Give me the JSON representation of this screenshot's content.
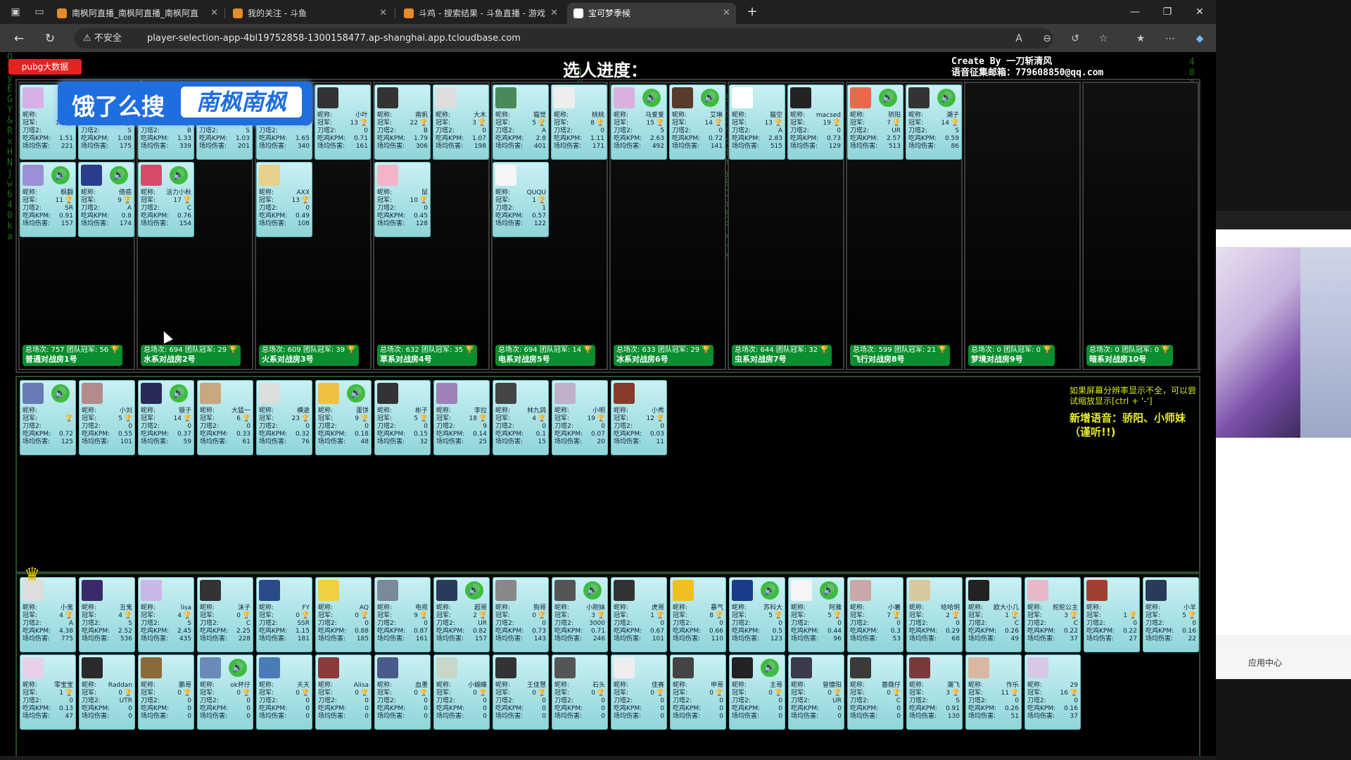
{
  "tabs": [
    {
      "title": "南枫阿直播_南枫阿直播_南枫阿直",
      "active": false
    },
    {
      "title": "我的关注 - 斗鱼",
      "active": false
    },
    {
      "title": "斗鸡 - 搜索结果 - 斗鱼直播 - 游戏",
      "active": false
    },
    {
      "title": "宝可梦季候",
      "active": true
    }
  ],
  "address": {
    "insecure_label": "不安全",
    "url": "player-selection-app-4bl19752858-1300158477.ap-shanghai.app.tcloudbase.com"
  },
  "page": {
    "pubg_button": "pubg大数据",
    "progress_title": "选人进度：",
    "credits_line1": "Create By 一刀斩清风",
    "credits_line2": "语音征集邮箱：779608850@qq.com",
    "banner_left": "饿了么搜",
    "banner_right": "南枫南枫",
    "hint": "如果屏幕分辨率显示不全，可以尝试缩放显示[ctrl + '-']",
    "hint2": "新增语音：骄阳、小师妹（谨听!!)"
  },
  "teams": [
    {
      "name": "普通对战房1号",
      "stats": "总场次: 757 团队冠军: 56"
    },
    {
      "name": "水系对战房2号",
      "stats": "总场次: 694 团队冠军: 29"
    },
    {
      "name": "火系对战房3号",
      "stats": "总场次: 609 团队冠军: 39"
    },
    {
      "name": "草系对战房4号",
      "stats": "总场次: 632 团队冠军: 35"
    },
    {
      "name": "电系对战房5号",
      "stats": "总场次: 694 团队冠军: 14"
    },
    {
      "name": "冰系对战房6号",
      "stats": "总场次: 633 团队冠军: 29"
    },
    {
      "name": "虫系对战房7号",
      "stats": "总场次: 644 团队冠军: 32"
    },
    {
      "name": "飞行对战房8号",
      "stats": "总场次: 599 团队冠军: 21"
    },
    {
      "name": "梦境对战房9号",
      "stats": "总场次: 0 团队冠军: 0"
    },
    {
      "name": "暗系对战房10号",
      "stats": "总场次: 0 团队冠军: 0"
    }
  ],
  "team_cards": [
    {
      "team": 0,
      "slot": 0,
      "name": "",
      "champ": "13",
      "tier": "",
      "kpm": "1.51",
      "dmg": "221",
      "color": "#d8b0e8"
    },
    {
      "team": 0,
      "slot": 1,
      "name": "",
      "champ": "23",
      "tier": "S",
      "kpm": "1.08",
      "dmg": "175",
      "color": "#ccc"
    },
    {
      "team": 0,
      "slot": 2,
      "name": "枫翻",
      "champ": "11",
      "tier": "SR",
      "kpm": "0.91",
      "dmg": "157",
      "color": "#9b8fd6",
      "voice": true
    },
    {
      "team": 0,
      "slot": 3,
      "name": "倚惑",
      "champ": "9",
      "tier": "A",
      "kpm": "0.8",
      "dmg": "174",
      "color": "#2b3d8a",
      "voice": true
    },
    {
      "team": 1,
      "slot": 0,
      "name": "",
      "champ": "1",
      "tier": "B",
      "kpm": "1.33",
      "dmg": "339",
      "color": "#999"
    },
    {
      "team": 1,
      "slot": 1,
      "name": "",
      "champ": "11",
      "tier": "S",
      "kpm": "1.03",
      "dmg": "201",
      "color": "#777"
    },
    {
      "team": 1,
      "slot": 2,
      "name": "活力小秋",
      "champ": "17",
      "tier": "C",
      "kpm": "0.76",
      "dmg": "154",
      "color": "#d84a6a",
      "voice": true
    },
    {
      "team": 2,
      "slot": 0,
      "name": "",
      "champ": "13",
      "tier": "",
      "kpm": "1.65",
      "dmg": "340",
      "color": "#bbb"
    },
    {
      "team": 2,
      "slot": 1,
      "name": "小叶",
      "champ": "13",
      "tier": "0",
      "kpm": "0.71",
      "dmg": "161",
      "color": "#333"
    },
    {
      "team": 2,
      "slot": 2,
      "name": "AXX",
      "champ": "13",
      "tier": "0",
      "kpm": "0.49",
      "dmg": "108",
      "color": "#e8d08a"
    },
    {
      "team": 3,
      "slot": 0,
      "name": "南帆",
      "champ": "22",
      "tier": "B",
      "kpm": "1.79",
      "dmg": "306",
      "color": "#333"
    },
    {
      "team": 3,
      "slot": 1,
      "name": "大木",
      "champ": "3",
      "tier": "0",
      "kpm": "1.07",
      "dmg": "198",
      "color": "#ddd"
    },
    {
      "team": 3,
      "slot": 2,
      "name": "鼠",
      "champ": "10",
      "tier": "0",
      "kpm": "0.45",
      "dmg": "128",
      "color": "#f2b5c8"
    },
    {
      "team": 4,
      "slot": 0,
      "name": "猫觉",
      "champ": "5",
      "tier": "A",
      "kpm": "2.8",
      "dmg": "401",
      "color": "#4a8a5a"
    },
    {
      "team": 4,
      "slot": 1,
      "name": "桃桃",
      "champ": "8",
      "tier": "0",
      "kpm": "1.11",
      "dmg": "171",
      "color": "#eee"
    },
    {
      "team": 4,
      "slot": 2,
      "name": "QUQU",
      "champ": "1",
      "tier": "1",
      "kpm": "0.57",
      "dmg": "122",
      "color": "#f5f5f5"
    },
    {
      "team": 5,
      "slot": 0,
      "name": "马爱爱",
      "champ": "15",
      "tier": "5",
      "kpm": "2.63",
      "dmg": "492",
      "color": "#d9b0e0",
      "voice": true
    },
    {
      "team": 5,
      "slot": 1,
      "name": "艾琳",
      "champ": "14",
      "tier": "0",
      "kpm": "0.72",
      "dmg": "141",
      "color": "#5a3a2a",
      "voice": true
    },
    {
      "team": 6,
      "slot": 0,
      "name": "猫空",
      "champ": "13",
      "tier": "A",
      "kpm": "2.83",
      "dmg": "515",
      "color": "#fff"
    },
    {
      "team": 6,
      "slot": 1,
      "name": "macsed",
      "champ": "19",
      "tier": "0",
      "kpm": "0.73",
      "dmg": "129",
      "color": "#222"
    },
    {
      "team": 7,
      "slot": 0,
      "name": "骄阳",
      "champ": "7",
      "tier": "UR",
      "kpm": "2.57",
      "dmg": "513",
      "color": "#e86a4a",
      "voice": true
    },
    {
      "team": 7,
      "slot": 1,
      "name": "潮子",
      "champ": "14",
      "tier": "S",
      "kpm": "0.59",
      "dmg": "86",
      "color": "#333",
      "voice": true
    }
  ],
  "pool_cards": [
    {
      "name": "",
      "champ": "",
      "tier": "",
      "kpm": "0.72",
      "dmg": "125",
      "color": "#6a7ab8",
      "voice": true
    },
    {
      "name": "小刘",
      "champ": "5",
      "tier": "0",
      "kpm": "0.55",
      "dmg": "101",
      "color": "#b58a8a"
    },
    {
      "name": "银子",
      "champ": "14",
      "tier": "0",
      "kpm": "0.37",
      "dmg": "59",
      "color": "#2a2a5a",
      "voice": true
    },
    {
      "name": "大猛一",
      "champ": "6",
      "tier": "0",
      "kpm": "0.33",
      "dmg": "61",
      "color": "#c9a880"
    },
    {
      "name": "横途",
      "champ": "23",
      "tier": "0",
      "kpm": "0.32",
      "dmg": "76",
      "color": "#ddd"
    },
    {
      "name": "蛋饼",
      "champ": "9",
      "tier": "0",
      "kpm": "0.18",
      "dmg": "48",
      "color": "#f0c040",
      "voice": true
    },
    {
      "name": "彬子",
      "champ": "5",
      "tier": "0",
      "kpm": "0.15",
      "dmg": "32",
      "color": "#333"
    },
    {
      "name": "李拉",
      "champ": "18",
      "tier": "9",
      "kpm": "0.14",
      "dmg": "25",
      "color": "#a080b8"
    },
    {
      "name": "林九鸽",
      "champ": "4",
      "tier": "0",
      "kpm": "0.1",
      "dmg": "15",
      "color": "#444"
    },
    {
      "name": "小明",
      "champ": "19",
      "tier": "0",
      "kpm": "0.07",
      "dmg": "20",
      "color": "#c0b0c8"
    },
    {
      "name": "小秀",
      "champ": "12",
      "tier": "0",
      "kpm": "0.03",
      "dmg": "11",
      "color": "#8a3a2a"
    }
  ],
  "all_cards_row1": [
    {
      "name": "小鬼",
      "champ": "4",
      "tier": "A",
      "kpm": "4.38",
      "dmg": "775",
      "color": "#ddd"
    },
    {
      "name": "丑鬼",
      "champ": "4",
      "tier": "S",
      "kpm": "2.52",
      "dmg": "536",
      "color": "#3a2a6a"
    },
    {
      "name": "lisa",
      "champ": "4",
      "tier": "S",
      "kpm": "2.45",
      "dmg": "435",
      "color": "#c8b8e8"
    },
    {
      "name": "沫子",
      "champ": "0",
      "tier": "C",
      "kpm": "2.25",
      "dmg": "228",
      "color": "#333"
    },
    {
      "name": "FY",
      "champ": "0",
      "tier": "SSR",
      "kpm": "1.15",
      "dmg": "181",
      "color": "#2a4a8a"
    },
    {
      "name": "AQ",
      "champ": "0",
      "tier": "0",
      "kpm": "0.88",
      "dmg": "185",
      "color": "#f0d040"
    },
    {
      "name": "电视",
      "champ": "9",
      "tier": "0",
      "kpm": "0.87",
      "dmg": "161",
      "color": "#7a8a9a"
    },
    {
      "name": "超哥",
      "champ": "2",
      "tier": "UR",
      "kpm": "0.82",
      "dmg": "157",
      "color": "#2a3a5a",
      "voice": true
    },
    {
      "name": "狗哥",
      "champ": "0",
      "tier": "0",
      "kpm": "0.73",
      "dmg": "143",
      "color": "#888"
    },
    {
      "name": "小刚妹",
      "champ": "3",
      "tier": "3000",
      "kpm": "0.71",
      "dmg": "246",
      "color": "#555",
      "voice": true
    },
    {
      "name": "虎哥",
      "champ": "1",
      "tier": "0",
      "kpm": "0.67",
      "dmg": "101",
      "color": "#333"
    },
    {
      "name": "暴气",
      "champ": "8",
      "tier": "0",
      "kpm": "0.66",
      "dmg": "110",
      "color": "#f0c020"
    },
    {
      "name": "苏科大",
      "champ": "5",
      "tier": "0",
      "kpm": "0.5",
      "dmg": "123",
      "color": "#1a3a8a",
      "voice": true
    },
    {
      "name": "阿雅",
      "champ": "5",
      "tier": "0",
      "kpm": "0.44",
      "dmg": "96",
      "color": "#f5f5f5",
      "voice": true
    },
    {
      "name": "小薯",
      "champ": "7",
      "tier": "0",
      "kpm": "0.3",
      "dmg": "53",
      "color": "#c8a8a8"
    },
    {
      "name": "哈哈明",
      "champ": "2",
      "tier": "0",
      "kpm": "0.29",
      "dmg": "68",
      "color": "#d8c8a0"
    },
    {
      "name": "欧大小几",
      "champ": "1",
      "tier": "C",
      "kpm": "0.26",
      "dmg": "49",
      "color": "#222"
    },
    {
      "name": "舵舵公主",
      "champ": "3",
      "tier": "C",
      "kpm": "0.22",
      "dmg": "37",
      "color": "#e8b8c8"
    },
    {
      "name": "",
      "champ": "1",
      "tier": "0",
      "kpm": "0.22",
      "dmg": "27",
      "color": "#a04030"
    },
    {
      "name": "小羊",
      "champ": "5",
      "tier": "0",
      "kpm": "0.16",
      "dmg": "22",
      "color": "#2a3a5a"
    }
  ],
  "all_cards_row2": [
    {
      "name": "零宝宝",
      "champ": "1",
      "tier": "0",
      "kpm": "0.13",
      "dmg": "47",
      "color": "#e8d0e8"
    },
    {
      "name": "Raddan",
      "champ": "0",
      "tier": "UTR",
      "kpm": "0",
      "dmg": "0",
      "color": "#2a2a2a"
    },
    {
      "name": "鹏哥",
      "champ": "0",
      "tier": "0",
      "kpm": "0",
      "dmg": "0",
      "color": "#8a6a3a"
    },
    {
      "name": "ok杯仔",
      "champ": "0",
      "tier": "0",
      "kpm": "0",
      "dmg": "0",
      "color": "#6a8ab8",
      "voice": true
    },
    {
      "name": "天天",
      "champ": "0",
      "tier": "0",
      "kpm": "0",
      "dmg": "0",
      "color": "#4a7ab8"
    },
    {
      "name": "Alisa",
      "champ": "0",
      "tier": "0",
      "kpm": "0",
      "dmg": "0",
      "color": "#8a3a3a"
    },
    {
      "name": "血墨",
      "champ": "0",
      "tier": "0",
      "kpm": "0",
      "dmg": "0",
      "color": "#4a5a8a"
    },
    {
      "name": "小蝴蝶",
      "champ": "0",
      "tier": "0",
      "kpm": "0",
      "dmg": "0",
      "color": "#c8d8c8"
    },
    {
      "name": "王佳慧",
      "champ": "0",
      "tier": "0",
      "kpm": "0",
      "dmg": "0",
      "color": "#333"
    },
    {
      "name": "石头",
      "champ": "0",
      "tier": "0",
      "kpm": "0",
      "dmg": "0",
      "color": "#555"
    },
    {
      "name": "佳赛",
      "champ": "0",
      "tier": "0",
      "kpm": "0",
      "dmg": "0",
      "color": "#eee"
    },
    {
      "name": "甲哥",
      "champ": "0",
      "tier": "0",
      "kpm": "0",
      "dmg": "0",
      "color": "#444"
    },
    {
      "name": "主哥",
      "champ": "0",
      "tier": "0",
      "kpm": "0",
      "dmg": "0",
      "color": "#222",
      "voice": true
    },
    {
      "name": "曾慷阳",
      "champ": "0",
      "tier": "UR",
      "kpm": "0",
      "dmg": "0",
      "color": "#3a3a4a"
    },
    {
      "name": "蔷薇仔",
      "champ": "0",
      "tier": "C",
      "kpm": "0",
      "dmg": "0",
      "color": "#3a3a3a"
    },
    {
      "name": "潮飞",
      "champ": "3",
      "tier": "S",
      "kpm": "0.91",
      "dmg": "130",
      "color": "#7a3a3a"
    },
    {
      "name": "作乐",
      "champ": "11",
      "tier": "0",
      "kpm": "0.26",
      "dmg": "51",
      "color": "#d8b8a0"
    },
    {
      "name": "29",
      "champ": "16",
      "tier": "0",
      "kpm": "0.16",
      "dmg": "37",
      "color": "#d8c8e8"
    }
  ],
  "labels": {
    "nick": "昵称:",
    "champ": "冠军:",
    "tier": "刀塔2:",
    "kpm": "吃鸡KPM:",
    "dmg": "场均伤害:"
  },
  "side": {
    "bottom_label": "应用中心"
  }
}
